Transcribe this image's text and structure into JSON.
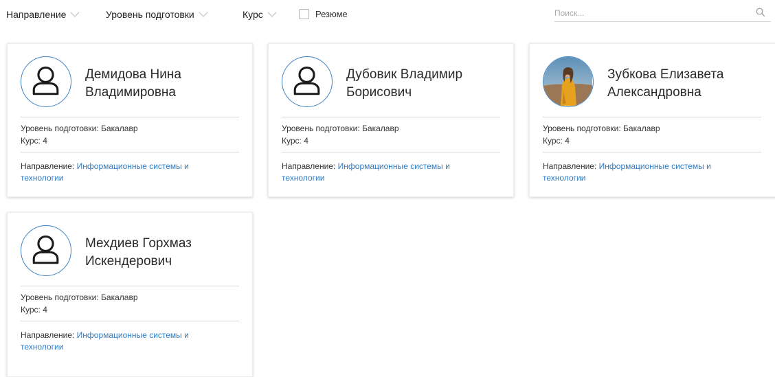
{
  "filters": {
    "direction": "Направление",
    "level": "Уровень подготовки",
    "course": "Курс",
    "resume": "Резюме"
  },
  "search": {
    "placeholder": "Поиск..."
  },
  "colors": {
    "accent": "#2f7bc4",
    "avatar_border": "#3e82c4"
  },
  "students": [
    {
      "name": "Демидова Нина Владимировна",
      "avatar": "user-icon",
      "level_label": "Уровень подготовки:",
      "level": "Бакалавр",
      "course_label": "Курс:",
      "course": "4",
      "direction_label": "Направление:",
      "direction": "Информационные системы и технологии"
    },
    {
      "name": "Дубовик Владимир Борисович",
      "avatar": "user-icon",
      "level_label": "Уровень подготовки:",
      "level": "Бакалавр",
      "course_label": "Курс:",
      "course": "4",
      "direction_label": "Направление:",
      "direction": "Информационные системы и технологии"
    },
    {
      "name": "Зубкова Елизавета Александровна",
      "avatar": "photo",
      "level_label": "Уровень подготовки:",
      "level": "Бакалавр",
      "course_label": "Курс:",
      "course": "4",
      "direction_label": "Направление:",
      "direction": "Информационные системы и технологии"
    },
    {
      "name": "Мехдиев Горхмаз Искендерович",
      "avatar": "user-icon",
      "level_label": "Уровень подготовки:",
      "level": "Бакалавр",
      "course_label": "Курс:",
      "course": "4",
      "direction_label": "Направление:",
      "direction": "Информационные системы и технологии"
    }
  ]
}
